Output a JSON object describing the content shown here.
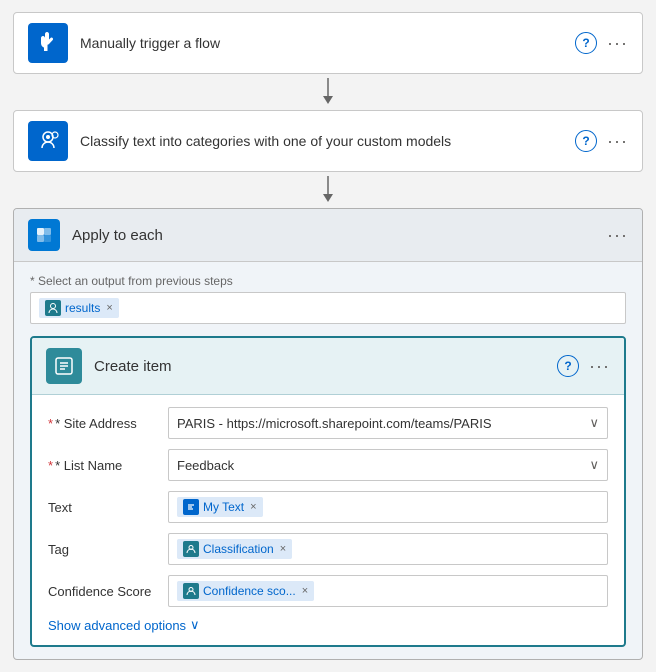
{
  "steps": [
    {
      "id": "manual-trigger",
      "icon_type": "blue",
      "icon_symbol": "hand",
      "title": "Manually trigger a flow"
    },
    {
      "id": "classify-text",
      "icon_type": "blue",
      "icon_symbol": "brain",
      "title": "Classify text into categories with one of your custom models"
    }
  ],
  "apply_to_each": {
    "title": "Apply to each",
    "select_label": "* Select an output from previous steps",
    "token_results": "results",
    "create_item": {
      "title": "Create item",
      "site_address_label": "* Site Address",
      "site_address_value": "PARIS - https://microsoft.sharepoint.com/teams/PARIS",
      "list_name_label": "* List Name",
      "list_name_value": "Feedback",
      "text_label": "Text",
      "text_token": "My Text",
      "tag_label": "Tag",
      "tag_token": "Classification",
      "confidence_score_label": "Confidence Score",
      "confidence_score_token": "Confidence sco..."
    },
    "show_advanced_label": "Show advanced options"
  },
  "icons": {
    "question": "?",
    "dots": "···",
    "close": "×",
    "chevron_down": "∨",
    "loop": "↻"
  }
}
